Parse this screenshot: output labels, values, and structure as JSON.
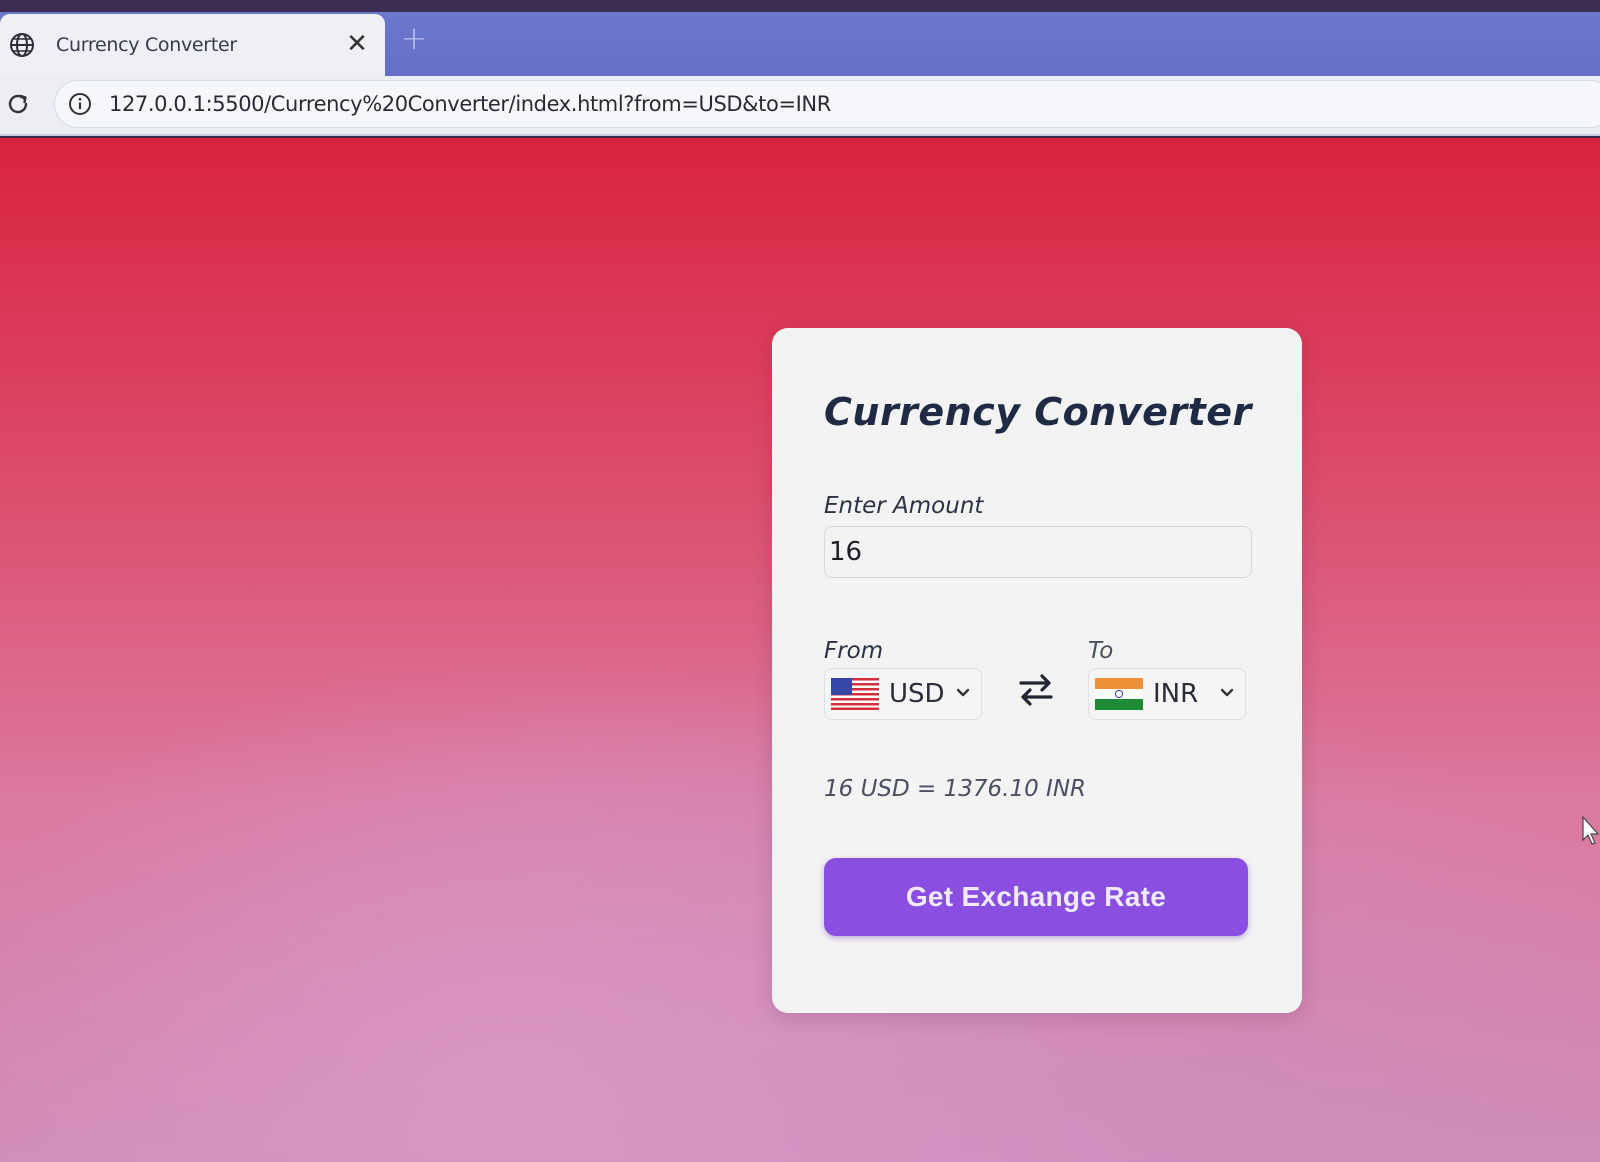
{
  "browser": {
    "tab_title": "Currency Converter",
    "tab_close": "✕",
    "new_tab": "+",
    "url": "127.0.0.1:5500/Currency%20Converter/index.html?from=USD&to=INR",
    "icons": [
      "globe-icon",
      "close-icon",
      "plus-icon",
      "reload-icon",
      "info-icon"
    ]
  },
  "converter": {
    "title": "Currency Converter",
    "amount_label": "Enter Amount",
    "amount_value": "16",
    "from_label": "From",
    "to_label": "To",
    "from_currency": "USD",
    "to_currency": "INR",
    "from_flag": "us-flag",
    "to_flag": "india-flag",
    "swap_icon": "swap-arrows-icon",
    "result": "16 USD = 1376.10 INR",
    "button_label": "Get Exchange Rate"
  },
  "colors": {
    "page_top": "#d9233e",
    "page_bottom": "#cf8db8",
    "card": "#f3f3f4",
    "title": "#1f2a44",
    "button": "#8a4fe0",
    "button_text": "#f0eaff"
  }
}
